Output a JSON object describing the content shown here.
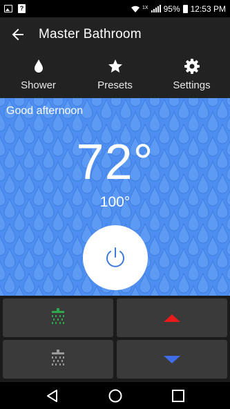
{
  "status_bar": {
    "battery": "95%",
    "time": "12:53 PM",
    "network_tag": "1X",
    "icons": [
      "image-icon",
      "unknown-app-icon",
      "wifi-icon",
      "signal-icon",
      "battery-icon"
    ]
  },
  "app_bar": {
    "title": "Master Bathroom",
    "back_icon": "arrow-left-icon"
  },
  "tabs": [
    {
      "label": "Shower",
      "icon": "droplet-icon"
    },
    {
      "label": "Presets",
      "icon": "star-icon"
    },
    {
      "label": "Settings",
      "icon": "gear-icon"
    }
  ],
  "hero": {
    "greeting": "Good afternoon",
    "current_temp": "72°",
    "target_temp": "100°",
    "power_icon": "power-icon",
    "background_color": "#4d8ef0"
  },
  "controls": {
    "outlet_1_icon": "shower-head-icon",
    "outlet_1_color": "#2ea84a",
    "outlet_2_icon": "shower-head-icon",
    "outlet_2_color": "#9a9a9a",
    "temp_up_icon": "arrow-up-icon",
    "temp_up_color": "#e81a1a",
    "temp_down_icon": "arrow-down-icon",
    "temp_down_color": "#3f6de6"
  },
  "nav_bar": {
    "icons": [
      "back-triangle-icon",
      "home-circle-icon",
      "recents-square-icon"
    ]
  }
}
